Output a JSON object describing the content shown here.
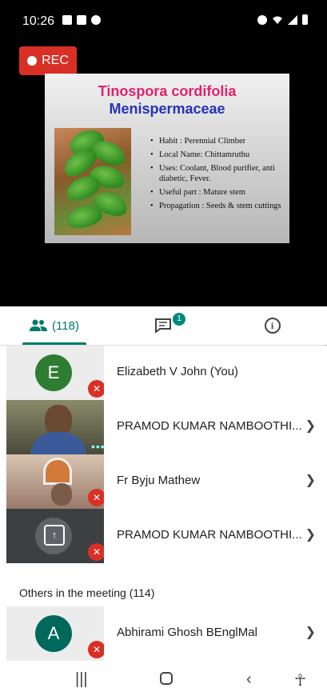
{
  "status_bar": {
    "time": "10:26"
  },
  "recording": {
    "label": "REC"
  },
  "slide": {
    "title": "Tinospora cordifolia",
    "subtitle": "Menispermaceae",
    "bullets": [
      "Habit : Perennial Climber",
      "Local Name: Chittamruthu",
      "Uses: Coolant, Blood purifier, anti diabetic, Fever.",
      "Useful part : Mature stem",
      "Propagation : Seeds & stem cuttings"
    ]
  },
  "tabs": {
    "people_count": "(118)",
    "chat_badge": "1",
    "info_symbol": "i"
  },
  "participants": [
    {
      "name": "Elizabeth V John (You)",
      "avatar_letter": "E"
    },
    {
      "name": "PRAMOD KUMAR NAMBOOTHI..."
    },
    {
      "name": "Fr Byju Mathew"
    },
    {
      "name": "PRAMOD KUMAR NAMBOOTHI..."
    }
  ],
  "others_header": "Others in the meeting (114)",
  "others": [
    {
      "name": "Abhirami Ghosh BEnglMal",
      "avatar_letter": "A"
    }
  ],
  "colors": {
    "accent": "#00796b",
    "record_red": "#d93025",
    "avatar_green": "#2e7d32",
    "avatar_teal": "#00695c"
  }
}
